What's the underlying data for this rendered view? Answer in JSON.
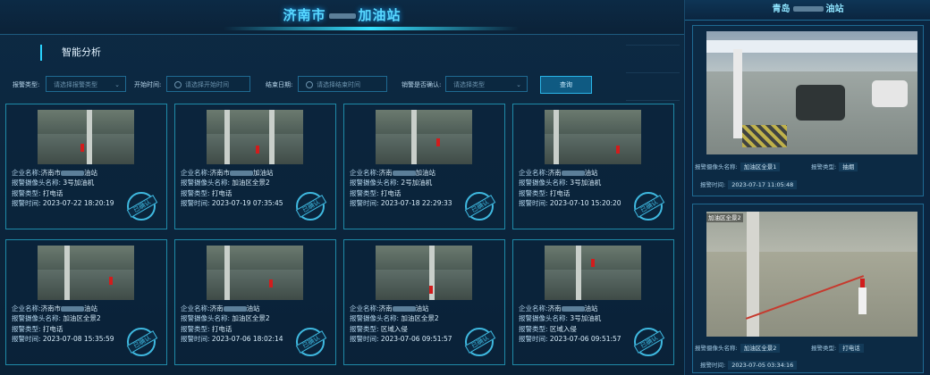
{
  "header": {
    "title_prefix": "济南市",
    "title_suffix": "加油站"
  },
  "section_title": "智能分析",
  "side_ghost": [
    "",
    "",
    ""
  ],
  "filters": {
    "alarm_type_label": "报警类型:",
    "alarm_type_placeholder": "请选择报警类型",
    "start_label": "开始时间:",
    "start_placeholder": "请选择开始时间",
    "end_label": "结束日期:",
    "end_placeholder": "请选择结束时间",
    "confirm_label": "销警是否确认:",
    "confirm_placeholder": "请选择类型",
    "query_label": "查询"
  },
  "labels": {
    "company": "企业名称:",
    "camera": "报警摄像头名称:",
    "type": "报警类型:",
    "time": "报警时间:",
    "stamp": "已确认"
  },
  "cards": [
    {
      "company_a": "济南市",
      "company_b": "油站",
      "camera": "3号加油机",
      "type": "打电话",
      "time": "2023-07-22 18:20:19"
    },
    {
      "company_a": "济南市",
      "company_b": "加油站",
      "camera": "加油区全景2",
      "type": "打电话",
      "time": "2023-07-19 07:35:45"
    },
    {
      "company_a": "济南",
      "company_b": "加油站",
      "camera": "2号加油机",
      "type": "打电话",
      "time": "2023-07-18 22:29:33"
    },
    {
      "company_a": "济南",
      "company_b": "油站",
      "camera": "3号加油机",
      "type": "打电话",
      "time": "2023-07-10 15:20:20"
    },
    {
      "company_a": "济南市",
      "company_b": "油站",
      "camera": "加油区全景2",
      "type": "打电话",
      "time": "2023-07-08 15:35:59"
    },
    {
      "company_a": "济南",
      "company_b": "油站",
      "camera": "加油区全景2",
      "type": "打电话",
      "time": "2023-07-06 18:02:14"
    },
    {
      "company_a": "济南",
      "company_b": "油站",
      "camera": "加油区全景2",
      "type": "区域入侵",
      "time": "2023-07-06 09:51:57"
    },
    {
      "company_a": "济南",
      "company_b": "油站",
      "camera": "3号加油机",
      "type": "区域入侵",
      "time": "2023-07-06 09:51:57"
    }
  ],
  "right": {
    "title_prefix": "青岛",
    "title_suffix": "油站",
    "camera_label": "报警摄像头名称:",
    "type_label": "报警类型:",
    "time_label": "报警时间:",
    "panels": [
      {
        "camera": "加油区全景1",
        "type": "抽烟",
        "time": "2023-07-17 11:05:48",
        "tag": ""
      },
      {
        "camera": "加油区全景2",
        "type": "打电话",
        "time": "2023-07-05 03:34:16",
        "tag": "加油区全景2"
      }
    ]
  }
}
